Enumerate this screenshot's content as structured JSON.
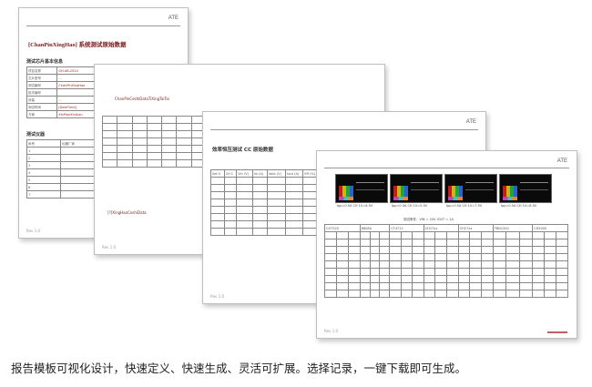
{
  "pages": {
    "p1": {
      "ate": "ATE",
      "title": "[ChanPinXingHao] 系统测试原始数据",
      "section_info": "测试芯片基本信息",
      "info_rows": [
        {
          "k": "项目名称",
          "v": "QH-AB-2024"
        },
        {
          "k": "芯片型号",
          "v": "..."
        },
        {
          "k": "测试编号",
          "v": "ChanPinXingHao"
        },
        {
          "k": "批次编号",
          "v": ""
        },
        {
          "k": "封装",
          "v": "..."
        },
        {
          "k": "测试时间",
          "v": "[DateTime]"
        },
        {
          "k": "方案",
          "v": "XinPianXinXian"
        }
      ],
      "section_instr": "测试仪器",
      "instr_header": [
        "序号",
        "仪器厂家"
      ],
      "instr_rows": [
        "1",
        "2",
        "3",
        "4",
        "5",
        "6",
        "7"
      ],
      "rev": "Rev 1.0"
    },
    "p2": {
      "header_text": "ChanPinCeshiDataTiXingTaiTai",
      "footer_text": "[?]XingHaoCeshiData",
      "rev": "Rev 1.0"
    },
    "p3": {
      "ate": "ATE",
      "title": "效率恒压测试 CC 原始数据",
      "cols": [
        "Set V",
        "CH 1",
        "Vin (V)",
        "Iin (A)",
        "Vout (V)",
        "Iout (A)",
        "Eff (%)"
      ],
      "rev": "Rev 1.0"
    },
    "p4": {
      "ate": "ATE",
      "captions": [
        "Ipp=0.5A CH 1V=6.5V",
        "Ipp=0.5A CH 1V=5.5V",
        "Ipp=0.5A CH 1V=7.5V",
        "Ipp=0.5A CH 1V=8.5V"
      ],
      "table_title": "测试条件：VIN = 24V    IOUT = 1A",
      "groups": [
        "CH7320",
        "8808A",
        "CT4712",
        "CH17xx",
        "CH27xx",
        "TBN1200",
        "CH5000"
      ],
      "rev": "Rev 1.0"
    }
  },
  "caption": "报告模板可视化设计，快速定义、快速生成、灵活可扩展。选择记录，一键下载即可生成。"
}
